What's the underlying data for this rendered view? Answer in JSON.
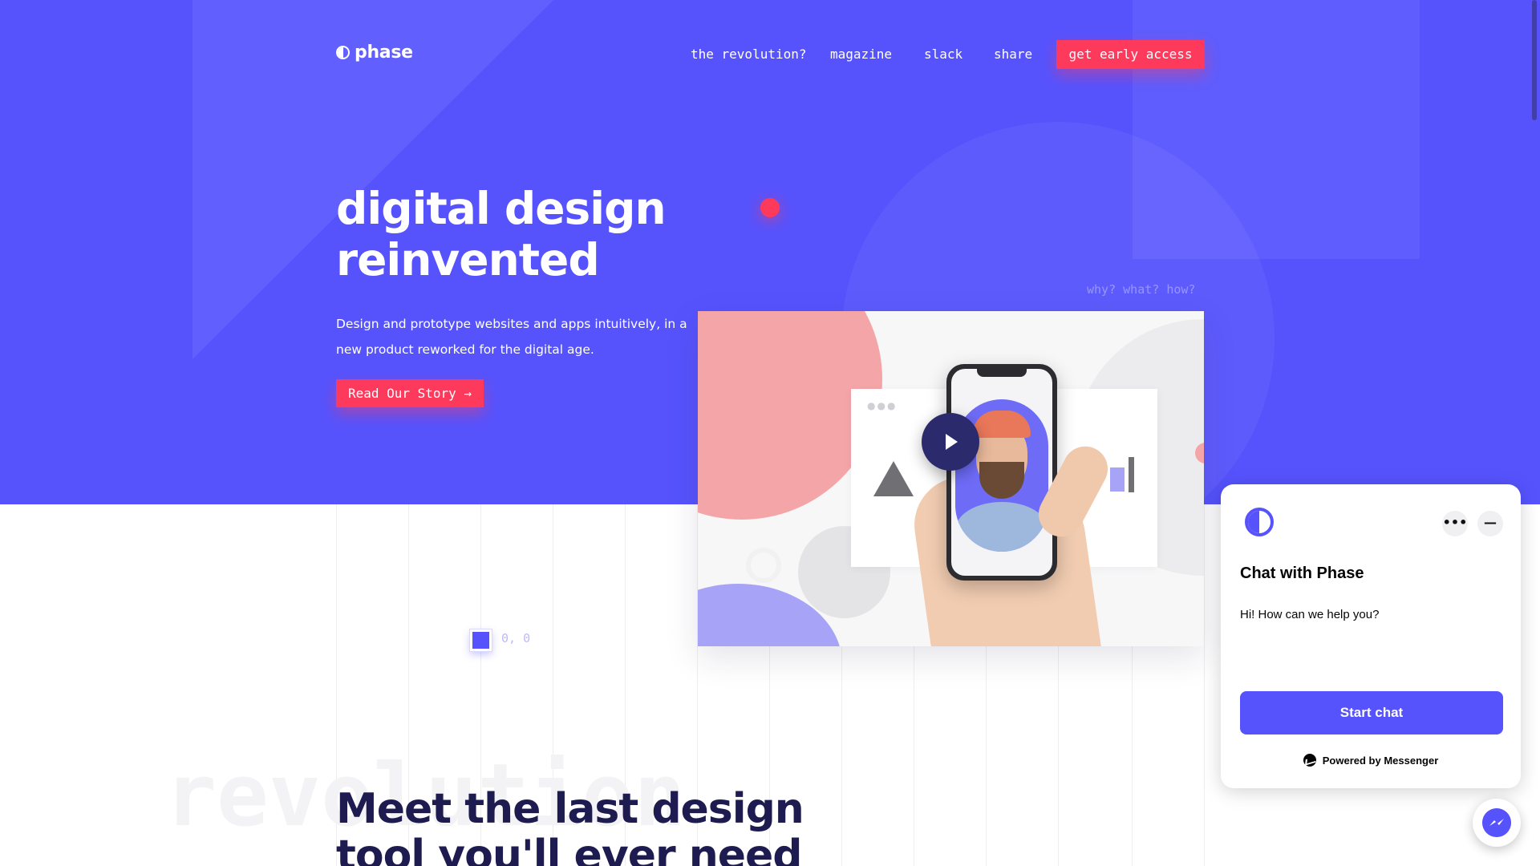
{
  "brand": {
    "name": "phase",
    "logo_icon": "half-circle-logo-icon"
  },
  "nav": {
    "links": [
      "the revolution?",
      "magazine",
      "slack",
      "share"
    ],
    "cta": "get early access"
  },
  "hero": {
    "title_line1": "digital design",
    "title_line2": "reinvented",
    "subtitle": "Design and prototype websites and apps intuitively, in a new product reworked for the digital age.",
    "button": "Read Our Story →",
    "side_caption": "why? what? how?",
    "video_icon": "play-icon"
  },
  "cursor": {
    "coords": "0, 0"
  },
  "section": {
    "background_word": "revolution",
    "title": "Meet the last design tool you'll ever need"
  },
  "chat": {
    "title": "Chat with Phase",
    "message": "Hi! How can we help you?",
    "start_button": "Start chat",
    "powered_by": "Powered by Messenger",
    "more_icon": "more-horizontal-icon",
    "minimize_icon": "minimize-icon",
    "fab_icon": "messenger-icon"
  },
  "colors": {
    "primary": "#5653fd",
    "accent": "#fd3a5c",
    "heading_dark": "#1d1b4f",
    "video_pink": "#f3a5a8",
    "video_purple": "#a7a4f7"
  }
}
